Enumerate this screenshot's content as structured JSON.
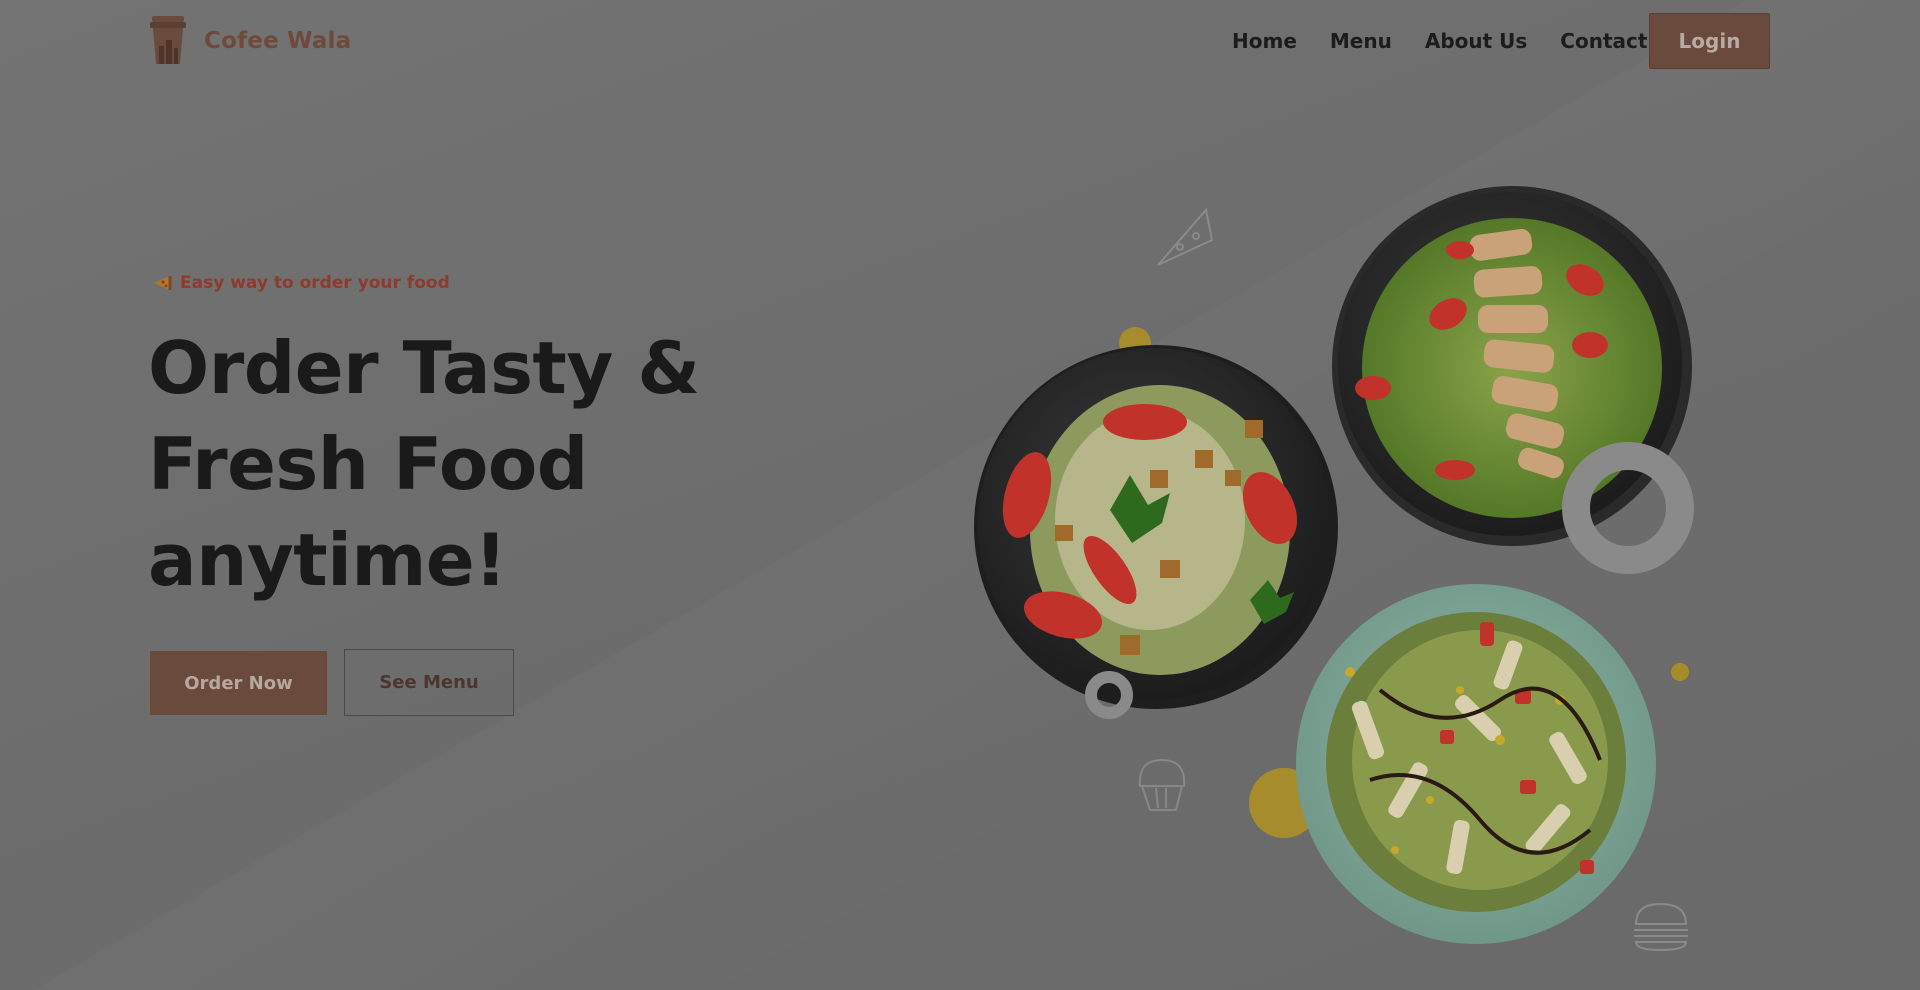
{
  "brand": {
    "name": "Cofee Wala",
    "logo_icon": "coffee-cup-icon"
  },
  "nav": {
    "links": [
      "Home",
      "Menu",
      "About Us",
      "Contact"
    ],
    "login_label": "Login"
  },
  "hero": {
    "tagline": "Easy way to order your food",
    "tagline_icon": "pizza-slice-icon",
    "headline_lines": [
      "Order Tasty &",
      "Fresh Food",
      "anytime!"
    ],
    "order_button": "Order Now",
    "menu_button": "See Menu"
  },
  "colors": {
    "accent_brown": "#6b4a3e",
    "tagline_red": "#8e3a2e",
    "mustard": "#b0912a",
    "overlay_gray": "#6e6e6e"
  },
  "decor_icons": [
    "pizza-outline-icon",
    "cupcake-outline-icon",
    "burger-outline-icon"
  ],
  "dish_images": [
    "salad-plate-dark-1",
    "chicken-salad-plate-dark",
    "pasta-salad-plate-teal"
  ]
}
